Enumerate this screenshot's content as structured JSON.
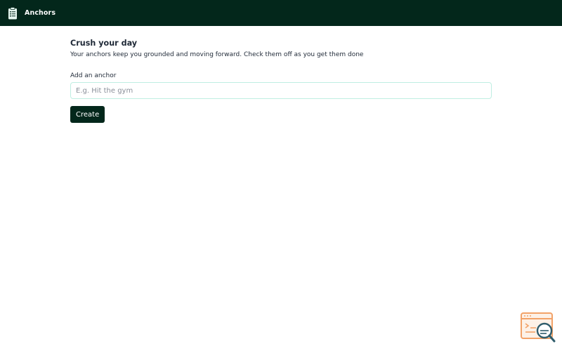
{
  "header": {
    "app_title": "Anchors",
    "logo_icon": "clipboard-list-icon"
  },
  "main": {
    "heading": "Crush your day",
    "subtitle": "Your anchors keep you grounded and moving forward. Check them off as you get them done",
    "input_label": "Add an anchor",
    "input_value": "",
    "input_placeholder": "E.g. Hit the gym",
    "create_label": "Create"
  },
  "corner_badge": {
    "icon": "browser-search-icon"
  },
  "colors": {
    "topbar": "#03271b",
    "button": "#03271b",
    "input_border": "#bfeee2",
    "badge_accent": "#f2a268"
  }
}
